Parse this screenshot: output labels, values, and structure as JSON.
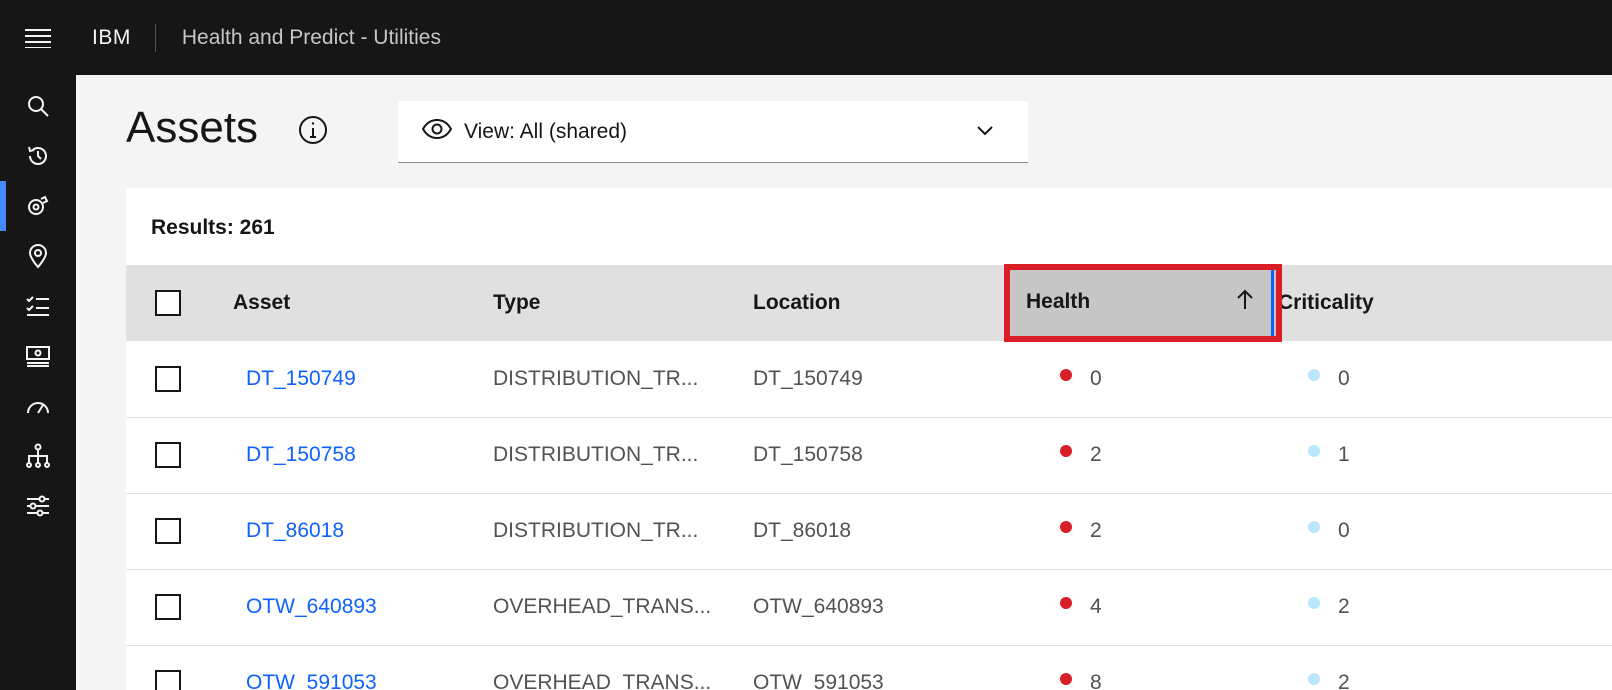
{
  "header": {
    "brand": "IBM",
    "app_title": "Health and Predict - Utilities"
  },
  "sidenav": {
    "items": [
      {
        "icon": "search-icon"
      },
      {
        "icon": "history-icon"
      },
      {
        "icon": "assets-icon",
        "active": true
      },
      {
        "icon": "location-icon"
      },
      {
        "icon": "checklist-icon"
      },
      {
        "icon": "dashboard-card-icon"
      },
      {
        "icon": "gauge-icon"
      },
      {
        "icon": "hierarchy-icon"
      },
      {
        "icon": "settings-sliders-icon"
      }
    ]
  },
  "page": {
    "title": "Assets"
  },
  "view_select": {
    "label": "View: All (shared)"
  },
  "results": {
    "label": "Results: 261"
  },
  "table": {
    "headers": {
      "asset": "Asset",
      "type": "Type",
      "location": "Location",
      "health": "Health",
      "criticality": "Criticality"
    },
    "rows": [
      {
        "asset": "DT_150749",
        "type": "DISTRIBUTION_TR...",
        "location": "DT_150749",
        "health": "0",
        "criticality": "0"
      },
      {
        "asset": "DT_150758",
        "type": "DISTRIBUTION_TR...",
        "location": "DT_150758",
        "health": "2",
        "criticality": "1"
      },
      {
        "asset": "DT_86018",
        "type": "DISTRIBUTION_TR...",
        "location": "DT_86018",
        "health": "2",
        "criticality": "0"
      },
      {
        "asset": "OTW_640893",
        "type": "OVERHEAD_TRANS...",
        "location": "OTW_640893",
        "health": "4",
        "criticality": "2"
      },
      {
        "asset": "OTW_591053",
        "type": "OVERHEAD_TRANS...",
        "location": "OTW_591053",
        "health": "8",
        "criticality": "2"
      }
    ]
  },
  "colors": {
    "health_dot": "#da1e28",
    "criticality_dot": "#bae6ff",
    "highlight": "#da1e28",
    "link": "#0f62fe"
  }
}
